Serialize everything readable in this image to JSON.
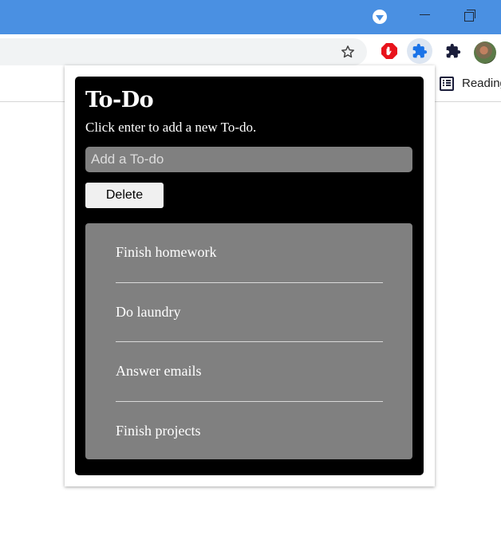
{
  "browser": {
    "bookmarks_bar": {
      "reading_list_label": "Reading"
    },
    "extensions": [
      {
        "icon": "adblock-stop-icon",
        "color": "#e8131c"
      },
      {
        "icon": "puzzle-icon",
        "color": "#1a73e8"
      },
      {
        "icon": "extensions-puzzle-icon",
        "color": "#1a1d3a"
      }
    ]
  },
  "popup": {
    "title": "To-Do",
    "subtitle": "Click enter to add a new To-do.",
    "input_placeholder": "Add a To-do",
    "input_value": "",
    "delete_label": "Delete",
    "todos": [
      {
        "text": "Finish homework"
      },
      {
        "text": "Do laundry"
      },
      {
        "text": "Answer emails"
      },
      {
        "text": "Finish projects"
      }
    ]
  },
  "colors": {
    "titlebar": "#4a90e2",
    "app_background": "#000000",
    "list_background": "#808080"
  }
}
